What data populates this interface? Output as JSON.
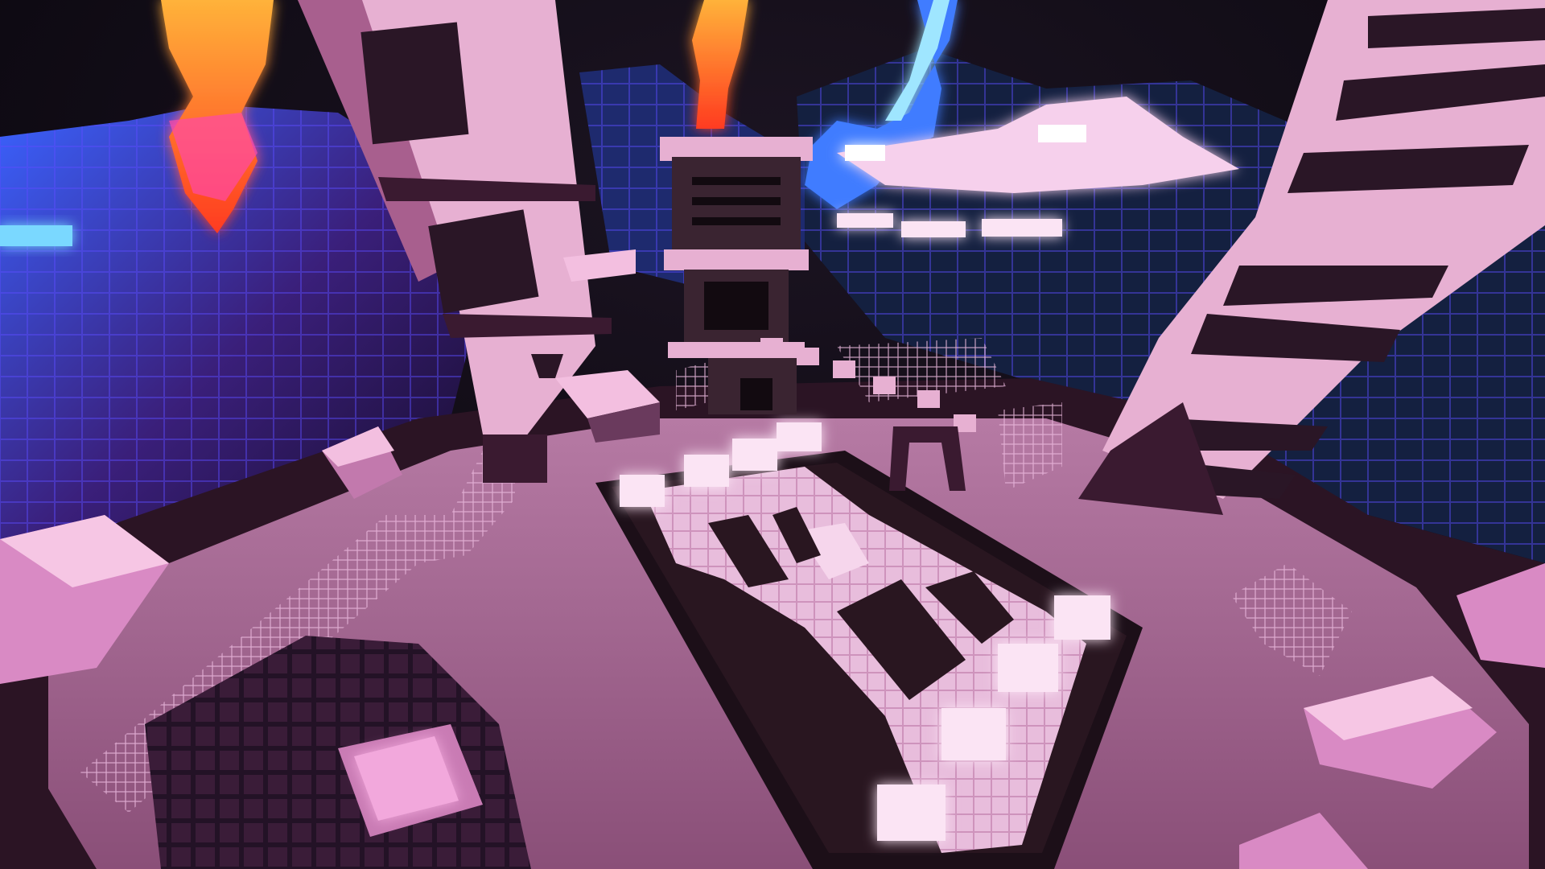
{
  "scene": {
    "palette": {
      "sky": "#0b0813",
      "pink_light": "#f3c7e6",
      "pink_mid": "#d98bc4",
      "pink_dark": "#5a2a4a",
      "floor": "#a06890",
      "lava_orange": "#ff7a1a",
      "lava_red": "#ff3b20",
      "glow_blue": "#3f7bff",
      "cyan_beam": "#7fd8ff",
      "purple_void": "#2a1b5e"
    },
    "elements": [
      "voxel-cloud-left",
      "lava-beam-left",
      "lava-beam-center",
      "blue-lightning-right",
      "tower-left",
      "tower-center",
      "tower-right",
      "glowing-cloud-platform",
      "glowing-tile-arena",
      "floating-cube-left",
      "floating-cube-right",
      "glass-fence",
      "dark-rock-bottom-left"
    ]
  }
}
